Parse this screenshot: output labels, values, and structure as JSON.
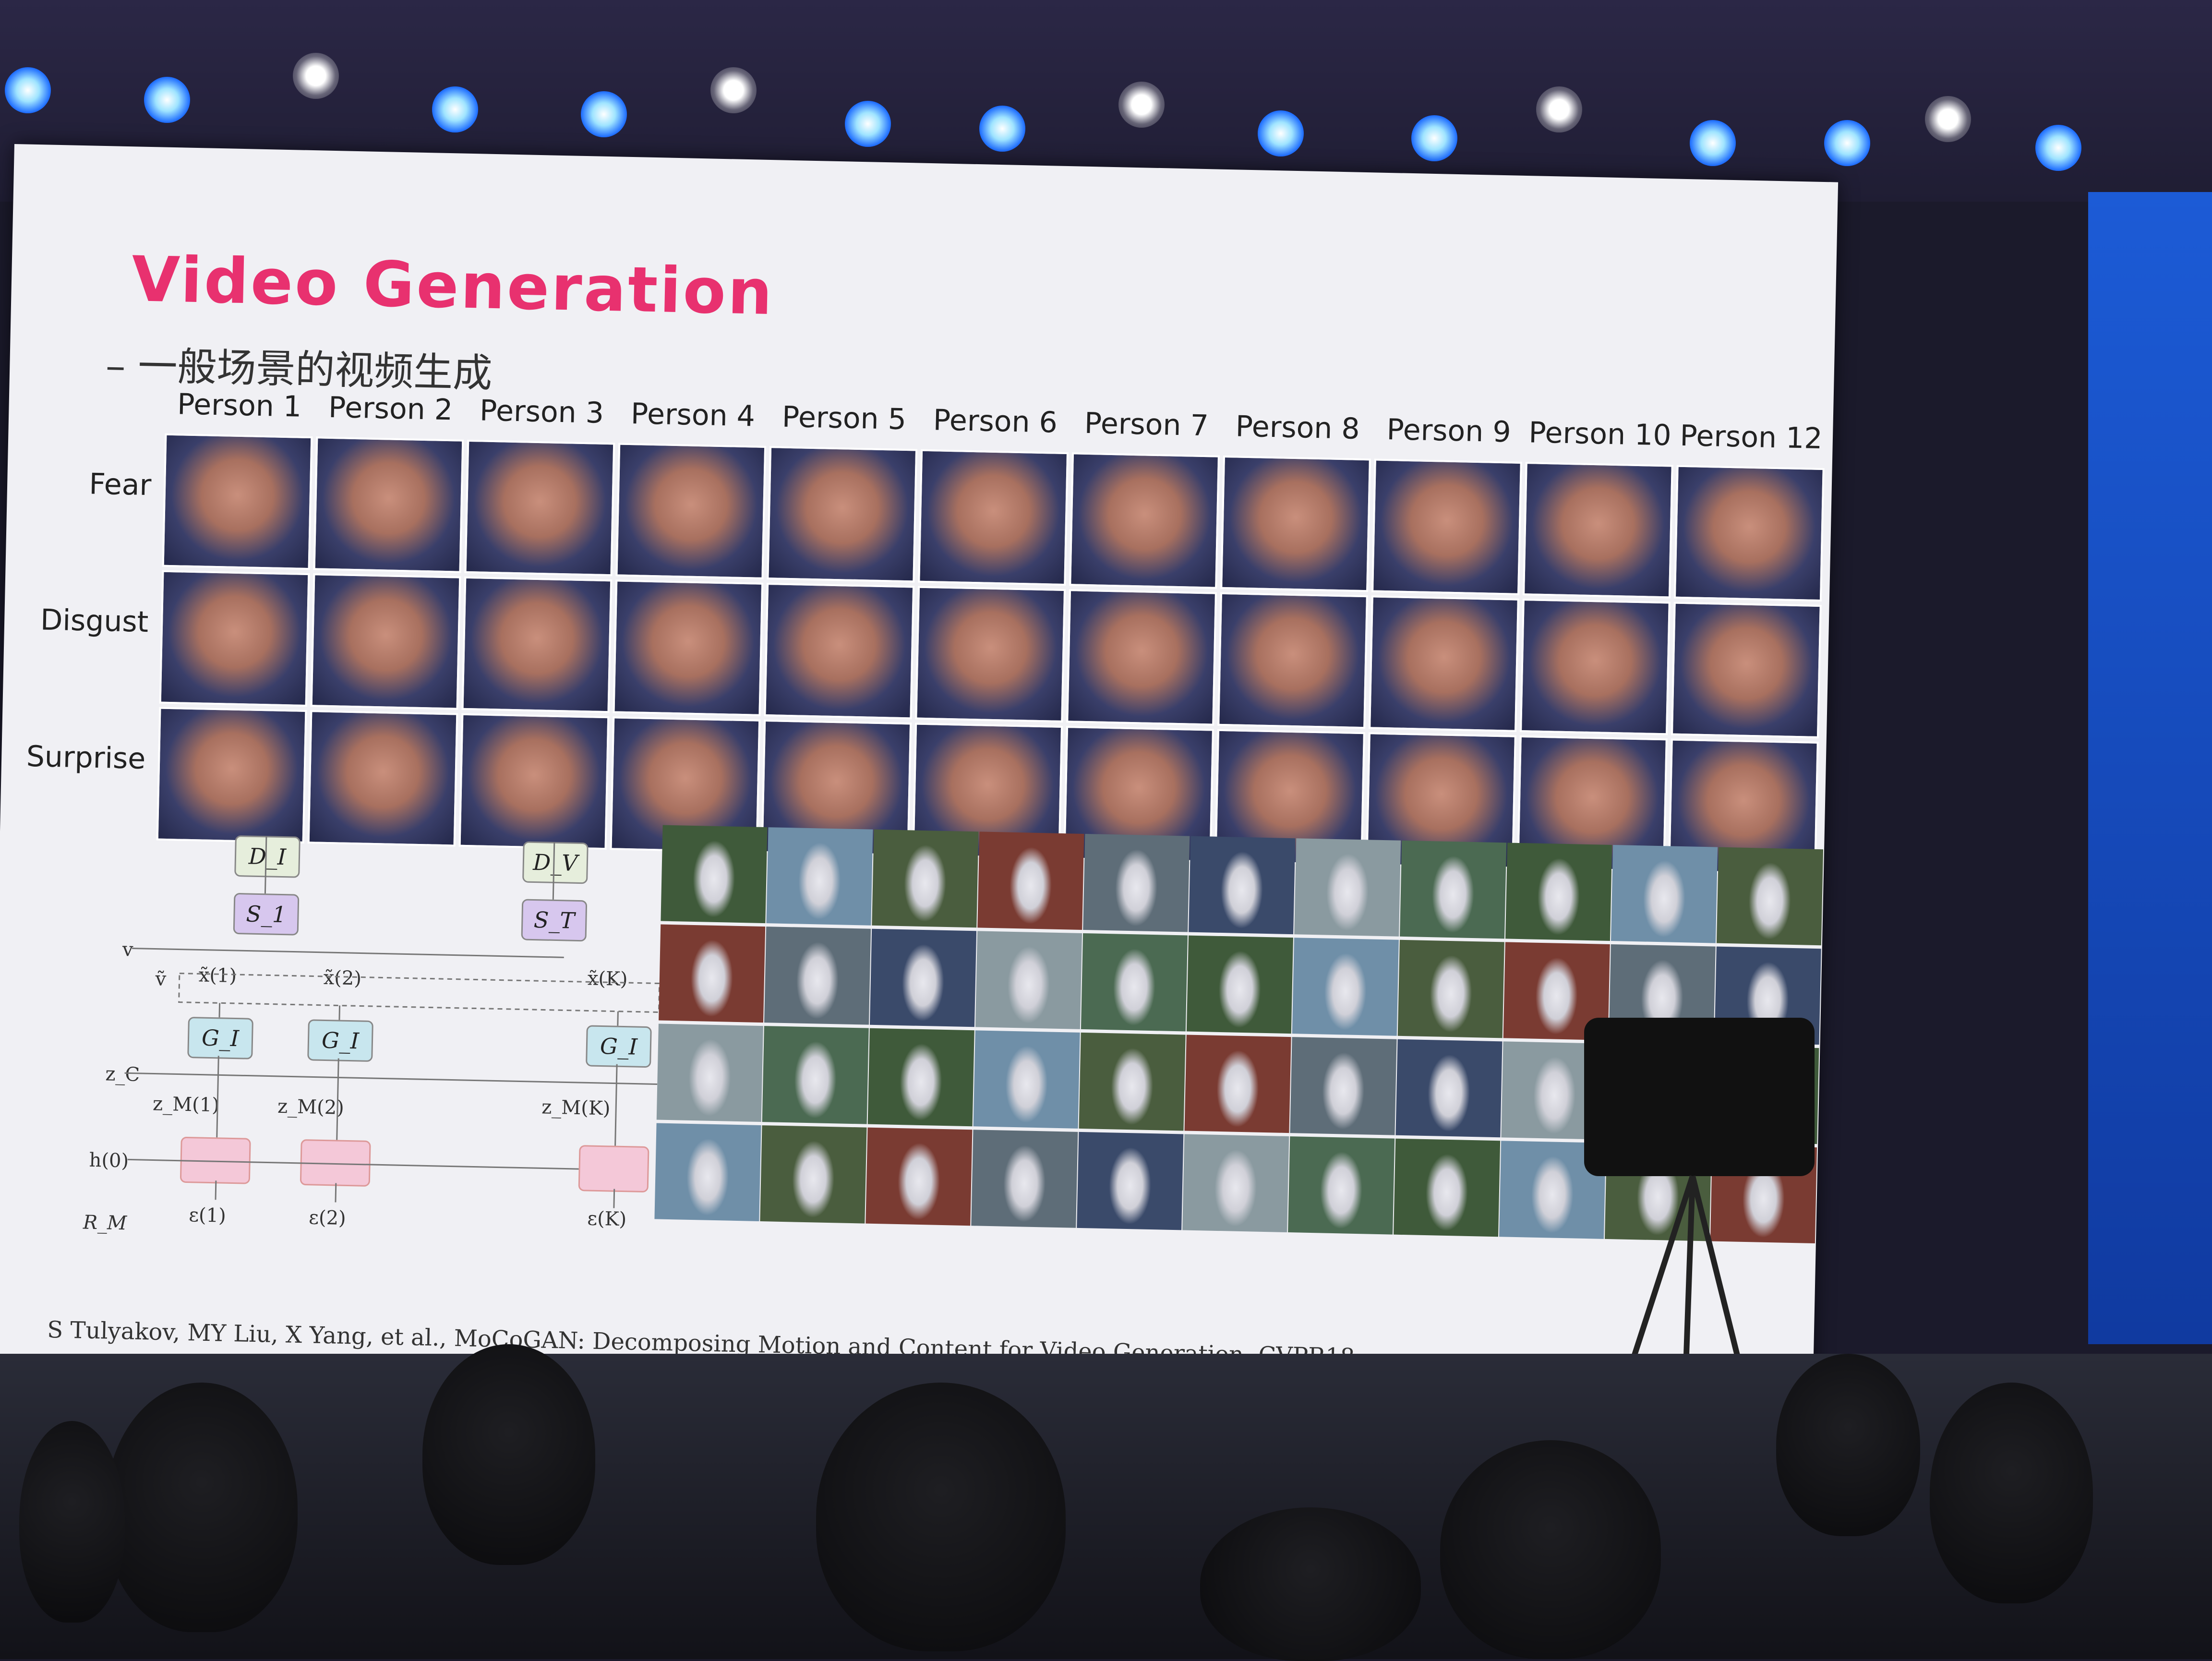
{
  "slide": {
    "title": "Video Generation",
    "subtitle": "– 一般场景的视频生成",
    "columns": [
      "Person 1",
      "Person 2",
      "Person 3",
      "Person 4",
      "Person 5",
      "Person 6",
      "Person 7",
      "Person 8",
      "Person 9",
      "Person 10",
      "Person 12"
    ],
    "rows": [
      "Fear",
      "Disgust",
      "Surprise"
    ],
    "diagram": {
      "discriminators": [
        "D_I",
        "D_V"
      ],
      "samplers": [
        "S_1",
        "S_T"
      ],
      "generators": [
        "G_I",
        "G_I",
        "G_I"
      ],
      "labels": [
        "v",
        "ṽ",
        "x̃(1)",
        "x̃(2)",
        "x̃(K)",
        "z_C",
        "z_M(1)",
        "z_M(2)",
        "z_M(K)",
        "h(0)",
        "ε(1)",
        "ε(2)",
        "ε(K)",
        "R_M"
      ]
    },
    "citation": "S Tulyakov, MY Liu, X Yang, et al., MoCoGAN: Decomposing Motion and Content for Video Generation, CVPR18."
  }
}
